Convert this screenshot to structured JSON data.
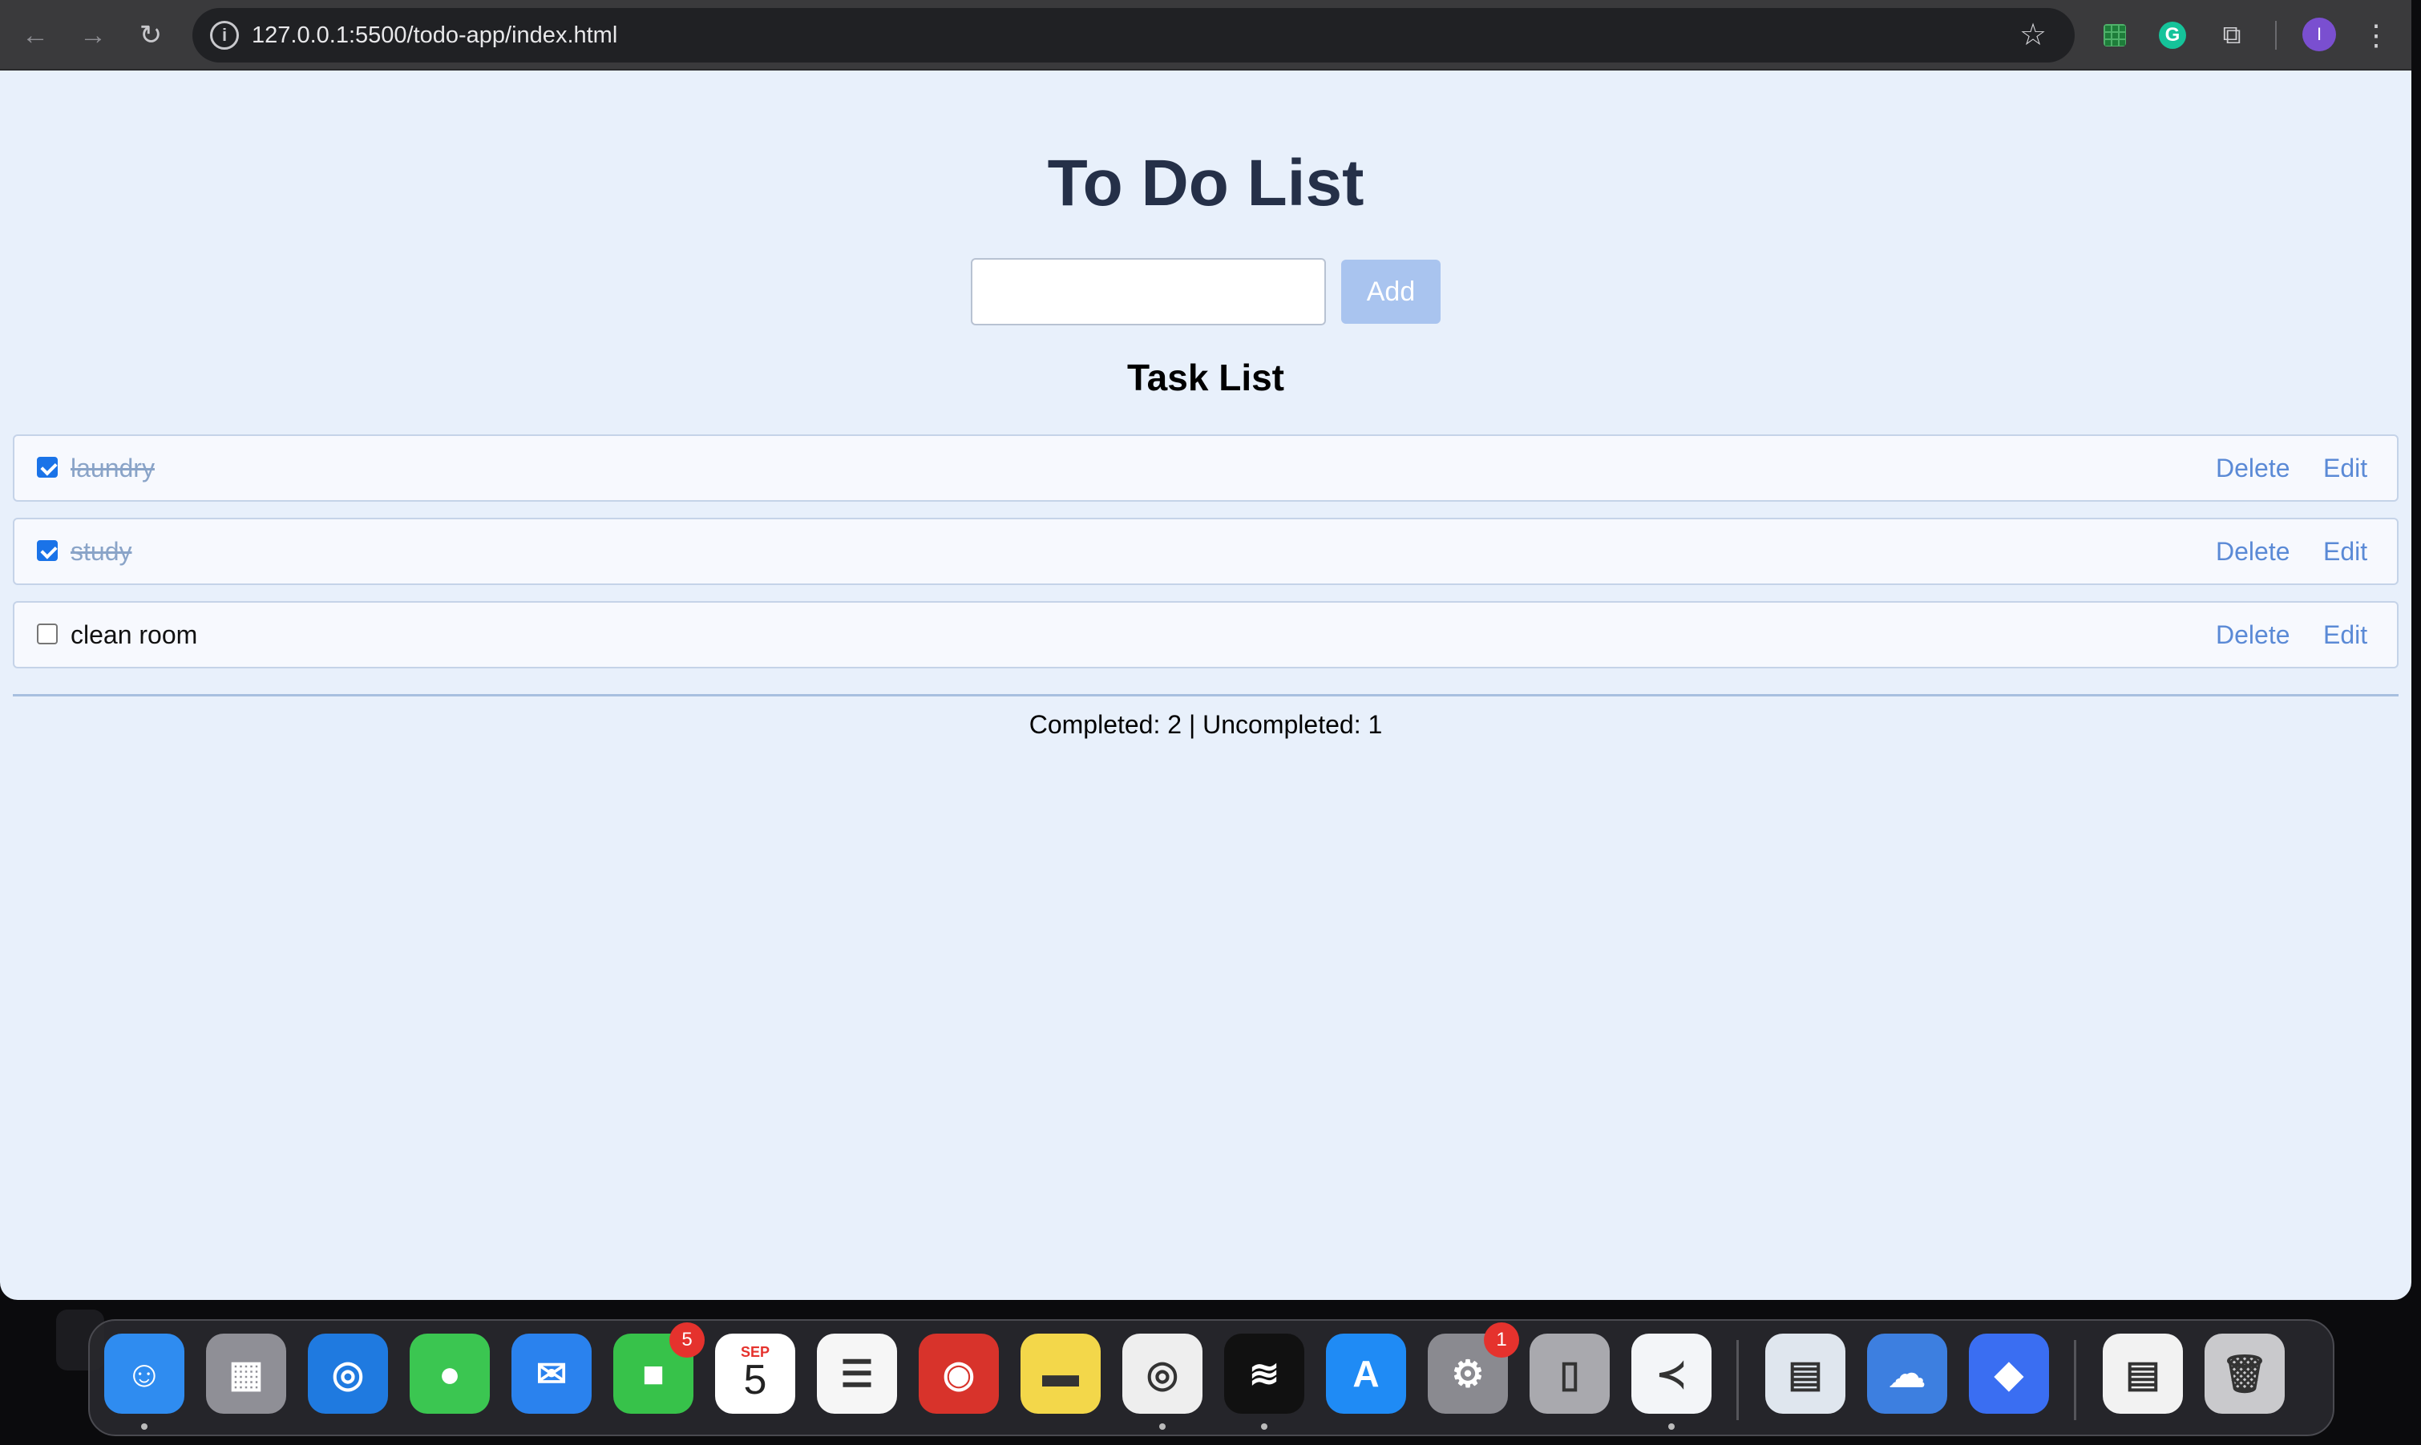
{
  "browser": {
    "url": "127.0.0.1:5500/todo-app/index.html",
    "back_icon": "←",
    "forward_icon": "→",
    "reload_icon": "↻",
    "star_icon": "☆",
    "puzzle_icon": "⧉",
    "grammarly_letter": "G",
    "profile_initial": "I",
    "menu_icon": "⋮"
  },
  "app": {
    "title": "To Do List",
    "input_placeholder": "",
    "add_label": "Add",
    "list_heading": "Task List",
    "tasks": [
      {
        "text": "laundry",
        "completed": true,
        "delete_label": "Delete",
        "edit_label": "Edit"
      },
      {
        "text": "study",
        "completed": true,
        "delete_label": "Delete",
        "edit_label": "Edit"
      },
      {
        "text": "clean room",
        "completed": false,
        "delete_label": "Delete",
        "edit_label": "Edit"
      }
    ],
    "stats": "Completed: 2 | Uncompleted: 1"
  },
  "dock": {
    "apps": [
      {
        "name": "Finder",
        "glyph": "☺",
        "color": "#2f8cf0",
        "badge": "",
        "running": true
      },
      {
        "name": "Launchpad",
        "glyph": "▦",
        "color": "#8f8f96",
        "badge": "",
        "running": false
      },
      {
        "name": "Safari",
        "glyph": "◎",
        "color": "#1f7ae0",
        "badge": "",
        "running": false
      },
      {
        "name": "Messages",
        "glyph": "●",
        "color": "#3bc651",
        "badge": "",
        "running": false
      },
      {
        "name": "Mail",
        "glyph": "✉",
        "color": "#2a82ee",
        "badge": "",
        "running": false
      },
      {
        "name": "FaceTime",
        "glyph": "■",
        "color": "#37c24a",
        "badge": "5",
        "running": false
      },
      {
        "name": "Calendar",
        "glyph": "5",
        "color": "#ffffff",
        "badge": "",
        "running": false,
        "month": "SEP"
      },
      {
        "name": "Reminders",
        "glyph": "☰",
        "color": "#f6f6f6",
        "badge": "",
        "running": false
      },
      {
        "name": "Photo Booth",
        "glyph": "◉",
        "color": "#d8332b",
        "badge": "",
        "running": false
      },
      {
        "name": "Notes",
        "glyph": "▬",
        "color": "#f3d74a",
        "badge": "",
        "running": false
      },
      {
        "name": "Chrome",
        "glyph": "◎",
        "color": "#eeeeee",
        "badge": "",
        "running": true
      },
      {
        "name": "Spotify",
        "glyph": "≋",
        "color": "#111111",
        "badge": "",
        "running": true
      },
      {
        "name": "App Store",
        "glyph": "A",
        "color": "#1f8bf5",
        "badge": "",
        "running": false
      },
      {
        "name": "System Settings",
        "glyph": "⚙",
        "color": "#8a8a90",
        "badge": "1",
        "running": false
      },
      {
        "name": "iPhone Mirroring",
        "glyph": "▯",
        "color": "#a9a9ae",
        "badge": "",
        "running": false
      },
      {
        "name": "VS Code",
        "glyph": "≺",
        "color": "#f3f5f8",
        "badge": "",
        "running": true
      },
      {
        "name": "Preview",
        "glyph": "▤",
        "color": "#dfe6ee",
        "badge": "",
        "running": false
      },
      {
        "name": "Weather",
        "glyph": "☁",
        "color": "#3d7fe0",
        "badge": "",
        "running": false
      },
      {
        "name": "Roblox",
        "glyph": "◆",
        "color": "#3a6ef2",
        "badge": "",
        "running": false
      },
      {
        "name": "Document",
        "glyph": "▤",
        "color": "#f2f2f2",
        "badge": "",
        "running": false
      },
      {
        "name": "Trash",
        "glyph": "🗑",
        "color": "#c9c9cc",
        "badge": "",
        "running": false
      }
    ]
  }
}
